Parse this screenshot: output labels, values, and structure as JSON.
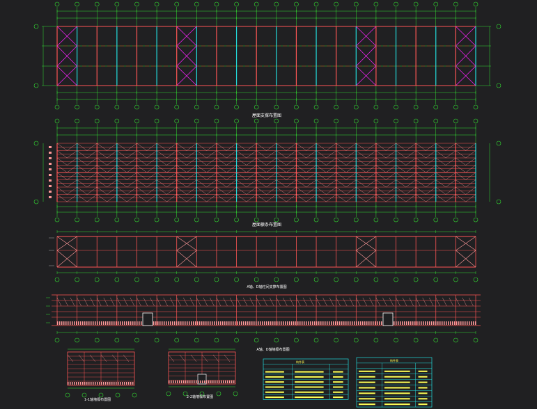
{
  "drawing": {
    "background": "#202022",
    "colors": {
      "grid": "#33dd33",
      "frame": "#ff5555",
      "column": "#22dddd",
      "brace": "#ee22ee",
      "dim": "#aaaaaa",
      "title": "#ffffff",
      "table": "#22dddd",
      "tableText": "#ffff55",
      "detail": "#ff9999",
      "dashed": "#cc2222"
    },
    "axis_count": 22,
    "braced_bays": [
      1,
      7,
      16,
      21
    ],
    "title_blocks": [
      {
        "id": "roof-support-plan",
        "label": "屋面支撑布置图"
      },
      {
        "id": "roof-purlin-plan",
        "label": "屋面檩条布置图"
      },
      {
        "id": "a-axis-elevation",
        "label": "A轴、D轴柱间支撑布置图"
      },
      {
        "id": "a-axis-wall-elevation",
        "label": "A轴、D轴墙檩布置图"
      },
      {
        "id": "section-1-1",
        "label": "1-1轴墙檩布置图"
      },
      {
        "id": "section-2-2",
        "label": "2-2轴墙檩布置图"
      }
    ],
    "tables": [
      {
        "id": "member-table-left",
        "title": "构件表",
        "rows": 6
      },
      {
        "id": "member-table-right",
        "title": "构件表",
        "rows": 7
      }
    ]
  }
}
